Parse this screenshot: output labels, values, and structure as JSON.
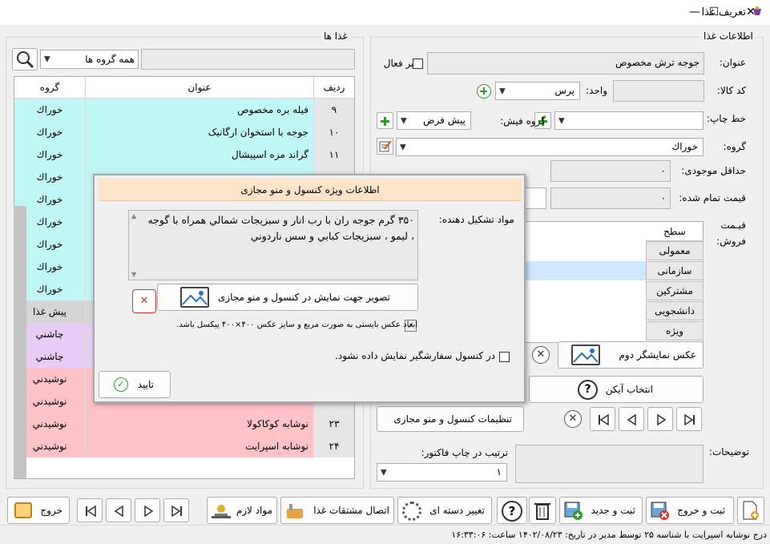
{
  "window": {
    "title": "تعریف غذا",
    "controls": [
      "—",
      "☐",
      "✕"
    ]
  },
  "left_panel": {
    "title": "غذا ها",
    "group_combo": "همه گروه ها",
    "columns": {
      "row": "ردیف",
      "title": "عنوان",
      "group": "گروه"
    },
    "rows": [
      {
        "num": "۹",
        "title": "فیله بره مخصوص",
        "group": "خوراك",
        "color": "#bff7f7"
      },
      {
        "num": "۱۰",
        "title": "جوجه با استخوان ارگانیک",
        "group": "خوراك",
        "color": "#bff7f7"
      },
      {
        "num": "۱۱",
        "title": "گراند مزه اسپیشال",
        "group": "خوراك",
        "color": "#bff7f7"
      },
      {
        "num": "",
        "title": "",
        "group": "خوراك",
        "color": "#bff7f7"
      },
      {
        "num": "",
        "title": "",
        "group": "خوراك",
        "color": "#bff7f7"
      },
      {
        "num": "",
        "title": "",
        "group": "خوراك",
        "color": "#bff7f7"
      },
      {
        "num": "",
        "title": "",
        "group": "خوراك",
        "color": "#bff7f7"
      },
      {
        "num": "",
        "title": "",
        "group": "خوراك",
        "color": "#bff7f7"
      },
      {
        "num": "",
        "title": "",
        "group": "خوراك",
        "color": "#bff7f7"
      },
      {
        "num": "",
        "title": "",
        "group": "پیش غذا",
        "color": "#d6d6d6"
      },
      {
        "num": "",
        "title": "",
        "group": "چاشني",
        "color": "#e9cdf7"
      },
      {
        "num": "",
        "title": "",
        "group": "چاشني",
        "color": "#e9cdf7"
      },
      {
        "num": "",
        "title": "",
        "group": "نوشيدني",
        "color": "#ffc2c7"
      },
      {
        "num": "",
        "title": "",
        "group": "نوشيدني",
        "color": "#ffc2c7"
      },
      {
        "num": "۲۳",
        "title": "نوشابه کوکاکولا",
        "group": "نوشيدني",
        "color": "#ffc2c7"
      },
      {
        "num": "۲۴",
        "title": "نوشابه اسپرایت",
        "group": "نوشيدني",
        "color": "#ffc2c7"
      }
    ]
  },
  "right_panel": {
    "title": "اطلاعات غذا",
    "title_label": "عنوان:",
    "title_value": "جوجه ترش مخصوص",
    "inactive_label": "غیر فعال",
    "code_label": "کد کالا:",
    "unit_label": "واحد:",
    "unit_value": "پرس",
    "print_label": "خط چاپ:",
    "receipt_group_label": "گروه فیش:",
    "receipt_group_value": "پیش فرض",
    "group_label": "گروه:",
    "group_value": "خوراك",
    "min_stock_label": "حداقل موجودی:",
    "min_stock_value": "۰",
    "cost_label": "قیمت تمام شده:",
    "cost_value": "۰",
    "sale_price_label_1": "قیـمت",
    "sale_price_label_2": "فروش:",
    "price_header": "سطح",
    "price_levels": [
      "معمولی",
      "سازمانی",
      "مشترکین",
      "دانشجویی",
      "ویژه"
    ],
    "second_display_image": "عکس نمایشگر دوم",
    "choose_icon": "انتخاب آیکن",
    "console_settings": "تنظیمات کنسول و منو مجازی",
    "invoice_order_label": "ترتیب در چاپ فاکتور:",
    "invoice_order_value": "۱",
    "notes_label": "توضیحات:"
  },
  "dialog": {
    "title": "اطلاعات ویژه کنسول و منو مجازی",
    "ingredients_label": "مواد تشکیل دهنده:",
    "ingredients_text": "۳۵۰ گرم جوجه ران با رب انار و سبزیجات شمالي همراه با گوجه ، ليمو ، سبزيجات کبابي و سس ناردوني",
    "image_button": "تصویر جهت نمایش در کنسول و منو مجازی",
    "image_note": "ابعاد عکس بایستی به صورت مربع و سایز عکس ۴۰۰×۴۰۰ پیکسل باشد.",
    "hide_checkbox": "در کنسول سفارشگیر نمایش داده نشود.",
    "ok_button": "تایید"
  },
  "toolbar": {
    "exit": "خروج",
    "requirements": "مواد لازم",
    "link_derivatives": "اتصال مشتقات غذا",
    "change_batch": "تغییر دسته ای",
    "save_new": "ثبت و جدید",
    "save_exit": "ثبت و خروج"
  },
  "status_text": "درج نوشابه اسپرایت با شناسه ۲۵ توسط مدیر در تاریخ: ۱۴۰۲/۰۸/۲۳ ساعت: ۱۶:۳۳:۰۶"
}
